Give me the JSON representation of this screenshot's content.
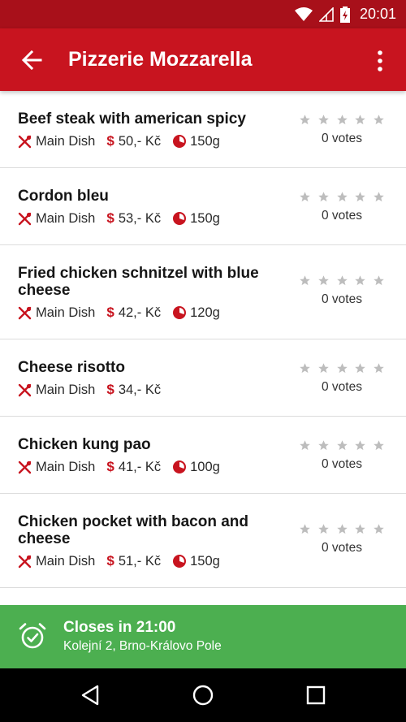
{
  "status_bar": {
    "time": "20:01"
  },
  "app_bar": {
    "title": "Pizzerie Mozzarella"
  },
  "menu_items": [
    {
      "name": "Beef steak with american spicy",
      "category": "Main Dish",
      "price": "50,- Kč",
      "weight": "150g",
      "votes": "0 votes"
    },
    {
      "name": "Cordon bleu",
      "category": "Main Dish",
      "price": "53,- Kč",
      "weight": "150g",
      "votes": "0 votes"
    },
    {
      "name": "Fried chicken schnitzel with blue cheese",
      "category": "Main Dish",
      "price": "42,- Kč",
      "weight": "120g",
      "votes": "0 votes"
    },
    {
      "name": "Cheese risotto",
      "category": "Main Dish",
      "price": "34,- Kč",
      "weight": "",
      "votes": "0 votes"
    },
    {
      "name": "Chicken kung pao",
      "category": "Main Dish",
      "price": "41,- Kč",
      "weight": "100g",
      "votes": "0 votes"
    },
    {
      "name": "Chicken pocket with bacon and cheese",
      "category": "Main Dish",
      "price": "51,- Kč",
      "weight": "150g",
      "votes": "0 votes"
    }
  ],
  "icons": {
    "price": "$",
    "category": "cutlery-icon",
    "weight": "weight-gauge-icon",
    "star": "star-icon",
    "alarm": "alarm-check-icon"
  },
  "footer": {
    "title": "Closes in 21:00",
    "address": "Kolejní 2, Brno-Královo Pole"
  },
  "colors": {
    "primary": "#c8141f",
    "status_bar": "#a8101a",
    "footer": "#4caf50",
    "star": "#bdbdbd"
  }
}
